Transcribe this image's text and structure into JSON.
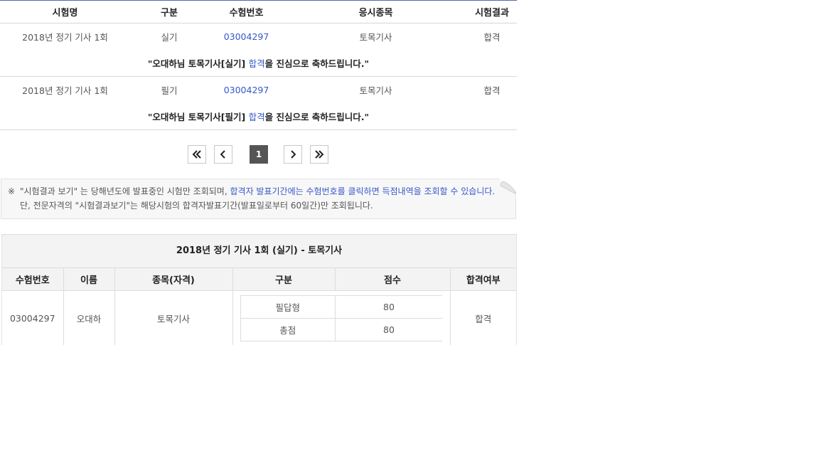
{
  "results_table": {
    "headers": [
      "시험명",
      "구분",
      "수험번호",
      "응시종목",
      "시험결과"
    ],
    "rows": [
      {
        "exam": "2018년 정기 기사 1회",
        "type": "실기",
        "number": "03004297",
        "subject": "토목기사",
        "result": "합격",
        "msg_prefix": "\"오대하님 토목기사[실기] ",
        "msg_link": "합격",
        "msg_suffix": "을 진심으로 축하드립니다.\""
      },
      {
        "exam": "2018년 정기 기사 1회",
        "type": "필기",
        "number": "03004297",
        "subject": "토목기사",
        "result": "합격",
        "msg_prefix": "\"오대하님 토목기사[필기] ",
        "msg_link": "합격",
        "msg_suffix": "을 진심으로 축하드립니다.\""
      }
    ]
  },
  "pagination": {
    "current_page": "1",
    "icons": [
      "first-page-icon",
      "prev-page-icon",
      "next-page-icon",
      "last-page-icon"
    ]
  },
  "notice": {
    "mark": "※",
    "text1": "\"시험결과 보기\" 는 당해년도에 발표중인 시험만 조회되며, ",
    "text_blue": "합격자 발표기간에는 수험번호를 클릭하면 득점내역을 조회할 수 있습니다.",
    "text2": " 단, 전문자격의 \"시험결과보기\"는 해당시험의 합격자발표기간(발표일로부터 60일간)만 조회됩니다."
  },
  "detail": {
    "title": "2018년 정기 기사 1회 (실기) - 토목기사",
    "headers": [
      "수험번호",
      "이름",
      "종목(자격)",
      "구분",
      "점수",
      "합격여부"
    ],
    "number": "03004297",
    "name": "오대하",
    "subject": "토목기사",
    "scores": [
      {
        "label": "필답형",
        "score": "80"
      },
      {
        "label": "총점",
        "score": "80"
      }
    ],
    "result": "합격"
  },
  "colors": {
    "link": "#3658c9",
    "header_line": "#4a6fa5",
    "current_page_bg": "#555555"
  }
}
